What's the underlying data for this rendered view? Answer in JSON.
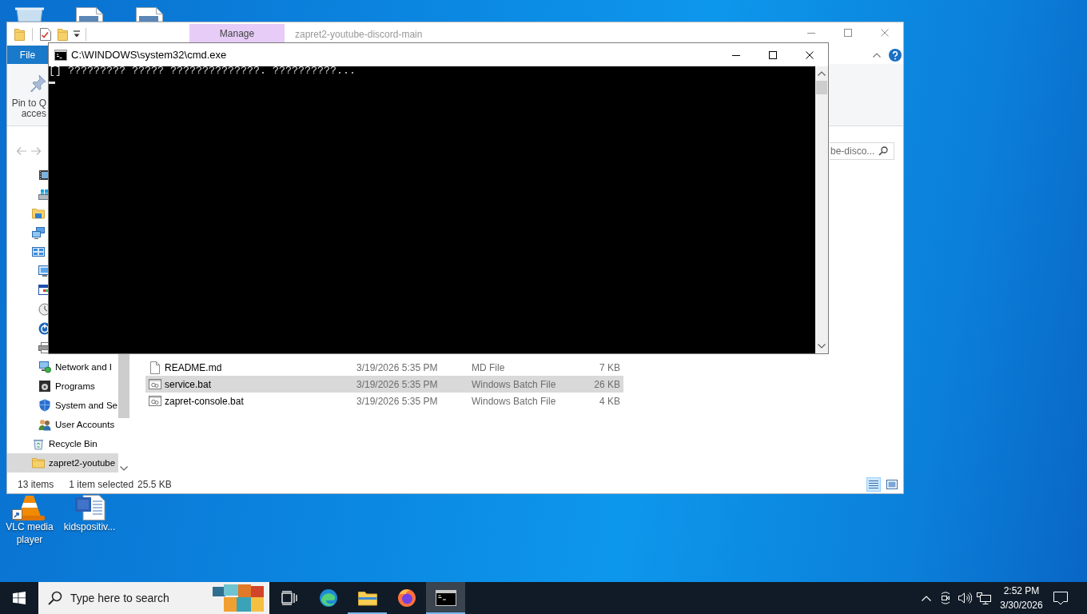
{
  "desktop": {
    "icons": [
      {
        "kind": "shortcut",
        "label": "VLC media player"
      },
      {
        "kind": "document",
        "label": "kidspositiv..."
      }
    ]
  },
  "explorer": {
    "context_tab": "Manage",
    "title": "zapret2-youtube-discord-main",
    "file_tab": "File",
    "ribbon": {
      "pin_button": {
        "lines": [
          "Pin to Q",
          "acces"
        ]
      }
    },
    "search": {
      "placeholder": "be-disco..."
    },
    "nav_pane": {
      "items": [
        {
          "children": [
            {
              "kind": "videos",
              "selected": false
            },
            {
              "kind": "drive",
              "selected": false
            }
          ]
        },
        {
          "kind": "folder_blue",
          "selected": false
        },
        {
          "kind": "network",
          "selected": false
        },
        {
          "kind": "control_panel",
          "selected": false,
          "children": [
            {
              "kind": "appearance",
              "selected": false
            },
            {
              "kind": "color_window",
              "selected": false
            },
            {
              "kind": "clock",
              "selected": false
            },
            {
              "kind": "ease",
              "selected": false
            },
            {
              "kind": "hardware",
              "selected": false
            },
            {
              "kind": "network_internet",
              "label": "Network and I",
              "selected": false
            },
            {
              "kind": "programs",
              "label": "Programs",
              "selected": false
            },
            {
              "kind": "security",
              "label": "System and Se",
              "selected": false
            },
            {
              "kind": "users",
              "label": "User Accounts",
              "selected": false
            }
          ]
        },
        {
          "kind": "recycle_bin",
          "label": "Recycle Bin",
          "selected": false
        },
        {
          "kind": "folder",
          "label": "zapret2-youtube",
          "selected": true
        }
      ]
    },
    "files": [
      {
        "kind": "document",
        "name": "README.md",
        "date": "3/19/2026 5:35 PM",
        "type": "MD File",
        "size": "7 KB",
        "selected": false
      },
      {
        "kind": "batch",
        "name": "service.bat",
        "date": "3/19/2026 5:35 PM",
        "type": "Windows Batch File",
        "size": "26 KB",
        "selected": true
      },
      {
        "kind": "batch",
        "name": "zapret-console.bat",
        "date": "3/19/2026 5:35 PM",
        "type": "Windows Batch File",
        "size": "4 KB",
        "selected": false
      }
    ],
    "status_bar": {
      "item_count": "13 items",
      "selection": "1 item selected",
      "selection_size": "25.5 KB",
      "views": [
        {
          "kind": "details",
          "selected": true
        },
        {
          "kind": "large_icons",
          "selected": false
        }
      ]
    }
  },
  "console": {
    "title": "C:\\WINDOWS\\system32\\cmd.exe",
    "lines": [
      "[] ????????? ????? ??????????????. ??????????..."
    ]
  },
  "taskbar": {
    "search": {
      "placeholder": "Type here to search"
    },
    "apps": [
      {
        "kind": "swirl_browser",
        "running": false,
        "selected": false
      },
      {
        "kind": "file_explorer",
        "running": true,
        "selected": false
      },
      {
        "kind": "fox_browser",
        "running": false,
        "selected": false
      },
      {
        "kind": "console",
        "running": true,
        "selected": true
      }
    ],
    "clock": {
      "time": "2:52 PM",
      "date": "3/30/2026"
    }
  }
}
